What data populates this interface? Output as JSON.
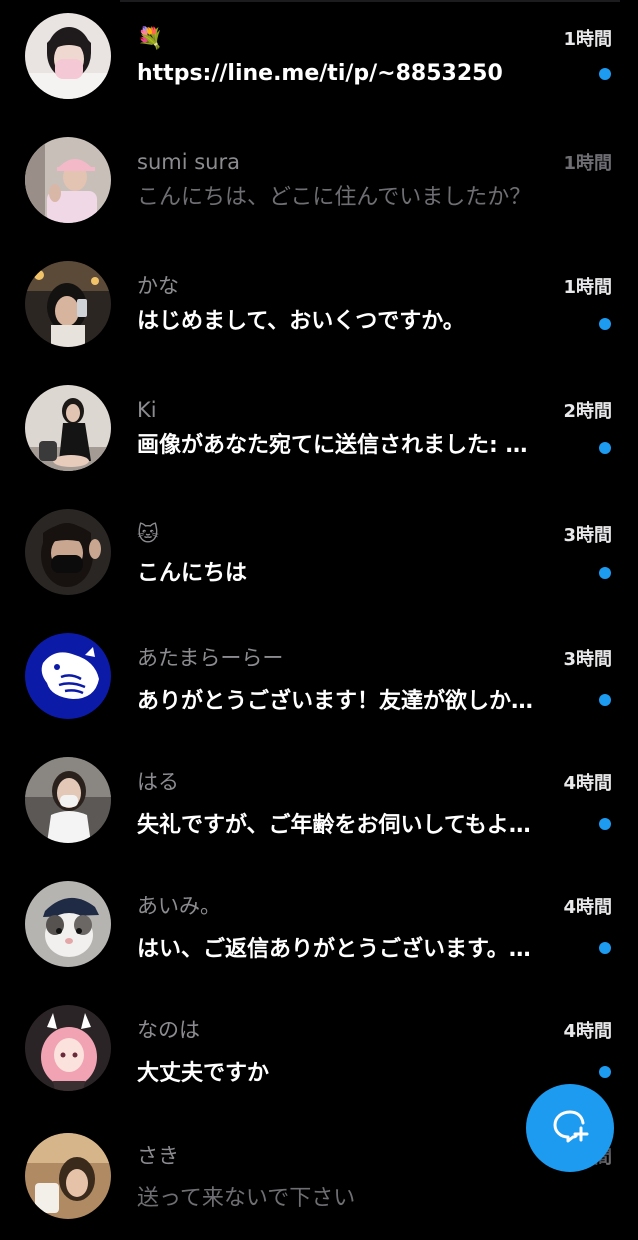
{
  "colors": {
    "background": "#000000",
    "accent": "#1d9bf0",
    "unread_dot": "#1d9bf0"
  },
  "conversations": [
    {
      "name": "💐",
      "time": "1時間",
      "message": "https://line.me/ti/p/~8853250",
      "unread": true
    },
    {
      "name": "sumi sura",
      "time": "1時間",
      "message": "こんにちは、どこに住んでいましたか？",
      "unread": false
    },
    {
      "name": "かな",
      "time": "1時間",
      "message": "はじめまして、おいくつですか。",
      "unread": true
    },
    {
      "name": "Ki",
      "time": "2時間",
      "message": "画像があなた宛てに送信されました: …",
      "unread": true
    },
    {
      "name": "🐱",
      "time": "3時間",
      "message": "こんにちは",
      "unread": true
    },
    {
      "name": "あたまらーらー",
      "time": "3時間",
      "message": "ありがとうございます！友達が欲しか…",
      "unread": true
    },
    {
      "name": "はる",
      "time": "4時間",
      "message": "失礼ですが、ご年齢をお伺いしてもよ…",
      "unread": true
    },
    {
      "name": "あいみ。",
      "time": "4時間",
      "message": "はい、ご返信ありがとうございます。…",
      "unread": true
    },
    {
      "name": "なのは",
      "time": "4時間",
      "message": "大丈夫ですか",
      "unread": true
    },
    {
      "name": "さき",
      "time": "4時間",
      "message": "送って来ないで下さい",
      "unread": false
    }
  ],
  "fab": {
    "icon": "new-message-icon"
  }
}
